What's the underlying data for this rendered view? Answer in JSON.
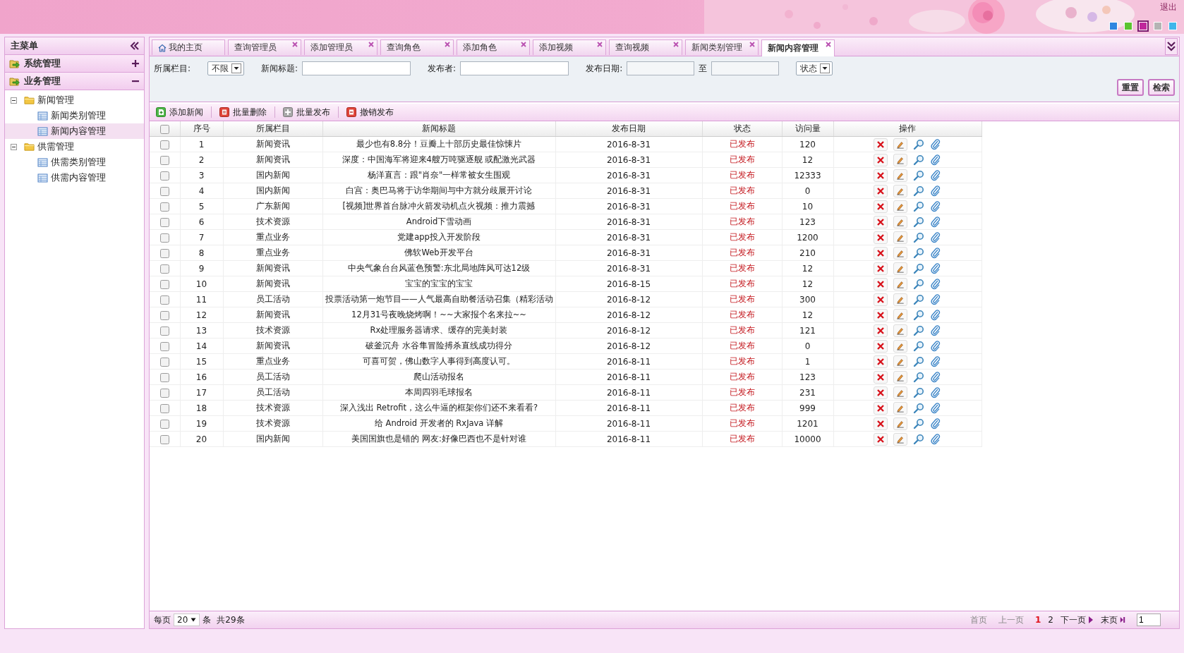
{
  "header": {
    "logout": "退出",
    "themes": [
      {
        "color": "#2f86e0",
        "selected": false
      },
      {
        "color": "#5cc431",
        "selected": false
      },
      {
        "color": "#c0279c",
        "selected": true
      },
      {
        "color": "#b4b4b4",
        "selected": false
      },
      {
        "color": "#3fb6ea",
        "selected": false
      }
    ]
  },
  "sidebar": {
    "title": "主菜单",
    "sections": [
      {
        "label": "系统管理",
        "expanded": false
      },
      {
        "label": "业务管理",
        "expanded": true,
        "children": [
          {
            "label": "新闻管理",
            "expanded": true,
            "children": [
              {
                "label": "新闻类别管理",
                "selected": false
              },
              {
                "label": "新闻内容管理",
                "selected": true
              }
            ]
          },
          {
            "label": "供需管理",
            "expanded": true,
            "children": [
              {
                "label": "供需类别管理",
                "selected": false
              },
              {
                "label": "供需内容管理",
                "selected": false
              }
            ]
          }
        ]
      }
    ]
  },
  "tabs": [
    {
      "label": "我的主页",
      "selected": false,
      "kind": "home"
    },
    {
      "label": "查询管理员",
      "selected": false,
      "kind": "closable"
    },
    {
      "label": "添加管理员",
      "selected": false,
      "kind": "closable"
    },
    {
      "label": "查询角色",
      "selected": false,
      "kind": "closable"
    },
    {
      "label": "添加角色",
      "selected": false,
      "kind": "closable"
    },
    {
      "label": "添加视频",
      "selected": false,
      "kind": "closable"
    },
    {
      "label": "查询视频",
      "selected": false,
      "kind": "closable"
    },
    {
      "label": "新闻类别管理",
      "selected": false,
      "kind": "closable"
    },
    {
      "label": "新闻内容管理",
      "selected": true,
      "kind": "closable"
    }
  ],
  "filters": [
    {
      "kind": "select",
      "label": "所属栏目:",
      "value": "不限"
    },
    {
      "kind": "text",
      "label": "新闻标题:"
    },
    {
      "kind": "text",
      "label": "发布者:"
    },
    {
      "kind": "daterange",
      "label": "发布日期:",
      "separator": "至"
    },
    {
      "kind": "select",
      "value": "状态"
    }
  ],
  "filter_buttons": [
    "重置",
    "检索"
  ],
  "toolbar": [
    {
      "label": "添加新闻",
      "kind": "add"
    },
    {
      "label": "批量删除",
      "kind": "delete"
    },
    {
      "label": "批量发布",
      "kind": "publish"
    },
    {
      "label": "撤销发布",
      "kind": "revoke"
    }
  ],
  "table": {
    "select_all": {
      "checked": false
    },
    "columns": [
      "序号",
      "所属栏目",
      "新闻标题",
      "发布日期",
      "状态",
      "访问量",
      "操作"
    ],
    "rows": [
      {
        "checked": false,
        "no": "1",
        "category": "新闻资讯",
        "title": "最少也有8.8分！豆瓣上十部历史最佳惊悚片",
        "date": "2016-8-31",
        "status": "已发布",
        "views": "120"
      },
      {
        "checked": false,
        "no": "2",
        "category": "新闻资讯",
        "title": "深度：中国海军将迎来4艘万吨驱逐舰 或配激光武器",
        "date": "2016-8-31",
        "status": "已发布",
        "views": "12"
      },
      {
        "checked": false,
        "no": "3",
        "category": "国内新闻",
        "title": "杨洋直言：跟\"肖奈\"一样常被女生围观",
        "date": "2016-8-31",
        "status": "已发布",
        "views": "12333"
      },
      {
        "checked": false,
        "no": "4",
        "category": "国内新闻",
        "title": "白宫：奥巴马将于访华期间与中方就分歧展开讨论",
        "date": "2016-8-31",
        "status": "已发布",
        "views": "0"
      },
      {
        "checked": false,
        "no": "5",
        "category": "广东新闻",
        "title": "[视频]世界首台脉冲火箭发动机点火视频：推力震撼",
        "date": "2016-8-31",
        "status": "已发布",
        "views": "10"
      },
      {
        "checked": false,
        "no": "6",
        "category": "技术资源",
        "title": "Android下雪动画",
        "date": "2016-8-31",
        "status": "已发布",
        "views": "123"
      },
      {
        "checked": false,
        "no": "7",
        "category": "重点业务",
        "title": "党建app投入开发阶段",
        "date": "2016-8-31",
        "status": "已发布",
        "views": "1200"
      },
      {
        "checked": false,
        "no": "8",
        "category": "重点业务",
        "title": "佛软Web开发平台",
        "date": "2016-8-31",
        "status": "已发布",
        "views": "210"
      },
      {
        "checked": false,
        "no": "9",
        "category": "新闻资讯",
        "title": "中央气象台台风蓝色预警:东北局地阵风可达12级",
        "date": "2016-8-31",
        "status": "已发布",
        "views": "12"
      },
      {
        "checked": false,
        "no": "10",
        "category": "新闻资讯",
        "title": "宝宝的宝宝的宝宝",
        "date": "2016-8-15",
        "status": "已发布",
        "views": "12"
      },
      {
        "checked": false,
        "no": "11",
        "category": "员工活动",
        "title": "投票活动第一炮节目——人气最高自助餐活动召集（精彩活动",
        "date": "2016-8-12",
        "status": "已发布",
        "views": "300"
      },
      {
        "checked": false,
        "no": "12",
        "category": "新闻资讯",
        "title": "12月31号夜晚烧烤啊！~~大家报个名来拉~~",
        "date": "2016-8-12",
        "status": "已发布",
        "views": "12"
      },
      {
        "checked": false,
        "no": "13",
        "category": "技术资源",
        "title": "Rx处理服务器请求、缓存的完美封装",
        "date": "2016-8-12",
        "status": "已发布",
        "views": "121"
      },
      {
        "checked": false,
        "no": "14",
        "category": "新闻资讯",
        "title": "破釜沉舟 水谷隼冒险搏杀直线成功得分",
        "date": "2016-8-12",
        "status": "已发布",
        "views": "0"
      },
      {
        "checked": false,
        "no": "15",
        "category": "重点业务",
        "title": "可喜可贺，佛山数字人事得到高度认可。",
        "date": "2016-8-11",
        "status": "已发布",
        "views": "1"
      },
      {
        "checked": false,
        "no": "16",
        "category": "员工活动",
        "title": "爬山活动报名",
        "date": "2016-8-11",
        "status": "已发布",
        "views": "123"
      },
      {
        "checked": false,
        "no": "17",
        "category": "员工活动",
        "title": "本周四羽毛球报名",
        "date": "2016-8-11",
        "status": "已发布",
        "views": "231"
      },
      {
        "checked": false,
        "no": "18",
        "category": "技术资源",
        "title": "深入浅出 Retrofit，这么牛逼的框架你们还不来看看?",
        "date": "2016-8-11",
        "status": "已发布",
        "views": "999"
      },
      {
        "checked": false,
        "no": "19",
        "category": "技术资源",
        "title": "给 Android 开发者的 RxJava 详解",
        "date": "2016-8-11",
        "status": "已发布",
        "views": "1201"
      },
      {
        "checked": false,
        "no": "20",
        "category": "国内新闻",
        "title": "美国国旗也是错的 网友:好像巴西也不是针对谁",
        "date": "2016-8-11",
        "status": "已发布",
        "views": "10000"
      }
    ]
  },
  "pager": {
    "per_page_label": "每页",
    "per_page": "20",
    "unit": "条",
    "total": "共29条",
    "links": [
      {
        "label": "首页",
        "disabled": true
      },
      {
        "label": "上一页",
        "disabled": true
      }
    ],
    "pages": [
      {
        "label": "1",
        "selected": true
      },
      {
        "label": "2",
        "selected": false
      }
    ],
    "next": [
      {
        "label": "下一页",
        "disabled": false,
        "kind": "next"
      },
      {
        "label": "末页",
        "disabled": false,
        "kind": "last"
      }
    ],
    "goto": "1"
  }
}
